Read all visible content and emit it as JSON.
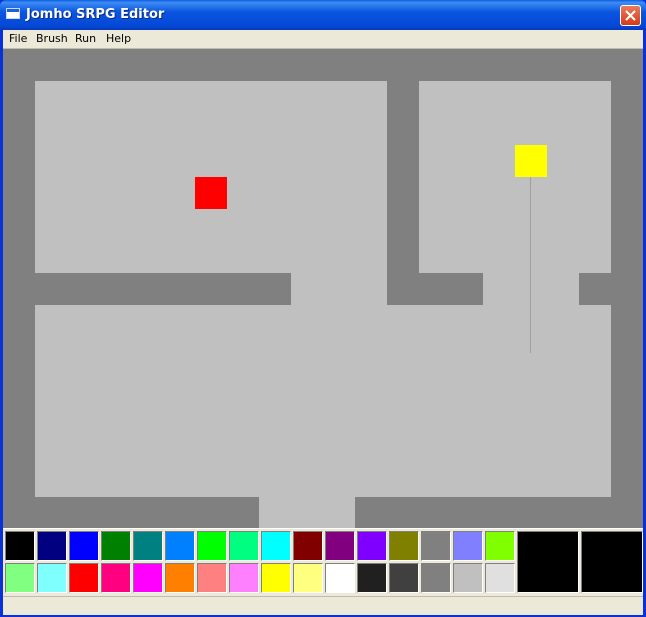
{
  "window": {
    "title": "Jomho SRPG Editor"
  },
  "menu": {
    "file": "File",
    "brush": "Brush",
    "run": "Run",
    "help": "Help"
  },
  "map": {
    "wall_color": "#808080",
    "floor_color": "#c0c0c0",
    "units": [
      {
        "name": "red-unit",
        "color": "#ff0000"
      },
      {
        "name": "yellow-unit",
        "color": "#ffff00"
      }
    ]
  },
  "palette": {
    "row1": [
      "#000000",
      "#000080",
      "#0000ff",
      "#008000",
      "#008080",
      "#0080ff",
      "#00ff00",
      "#00ff80",
      "#00ffff",
      "#800000",
      "#800080",
      "#8000ff",
      "#808000",
      "#808080",
      "#8080ff",
      "#80ff00"
    ],
    "row2": [
      "#80ff80",
      "#80ffff",
      "#ff0000",
      "#ff0080",
      "#ff00ff",
      "#ff8000",
      "#ff8080",
      "#ff80ff",
      "#ffff00",
      "#ffff80",
      "#ffffff",
      "#202020",
      "#404040",
      "#808080",
      "#c0c0c0",
      "#e0e0e0"
    ],
    "primary_color": "#000000",
    "secondary_color": "#000000"
  },
  "status": {
    "text": ""
  }
}
